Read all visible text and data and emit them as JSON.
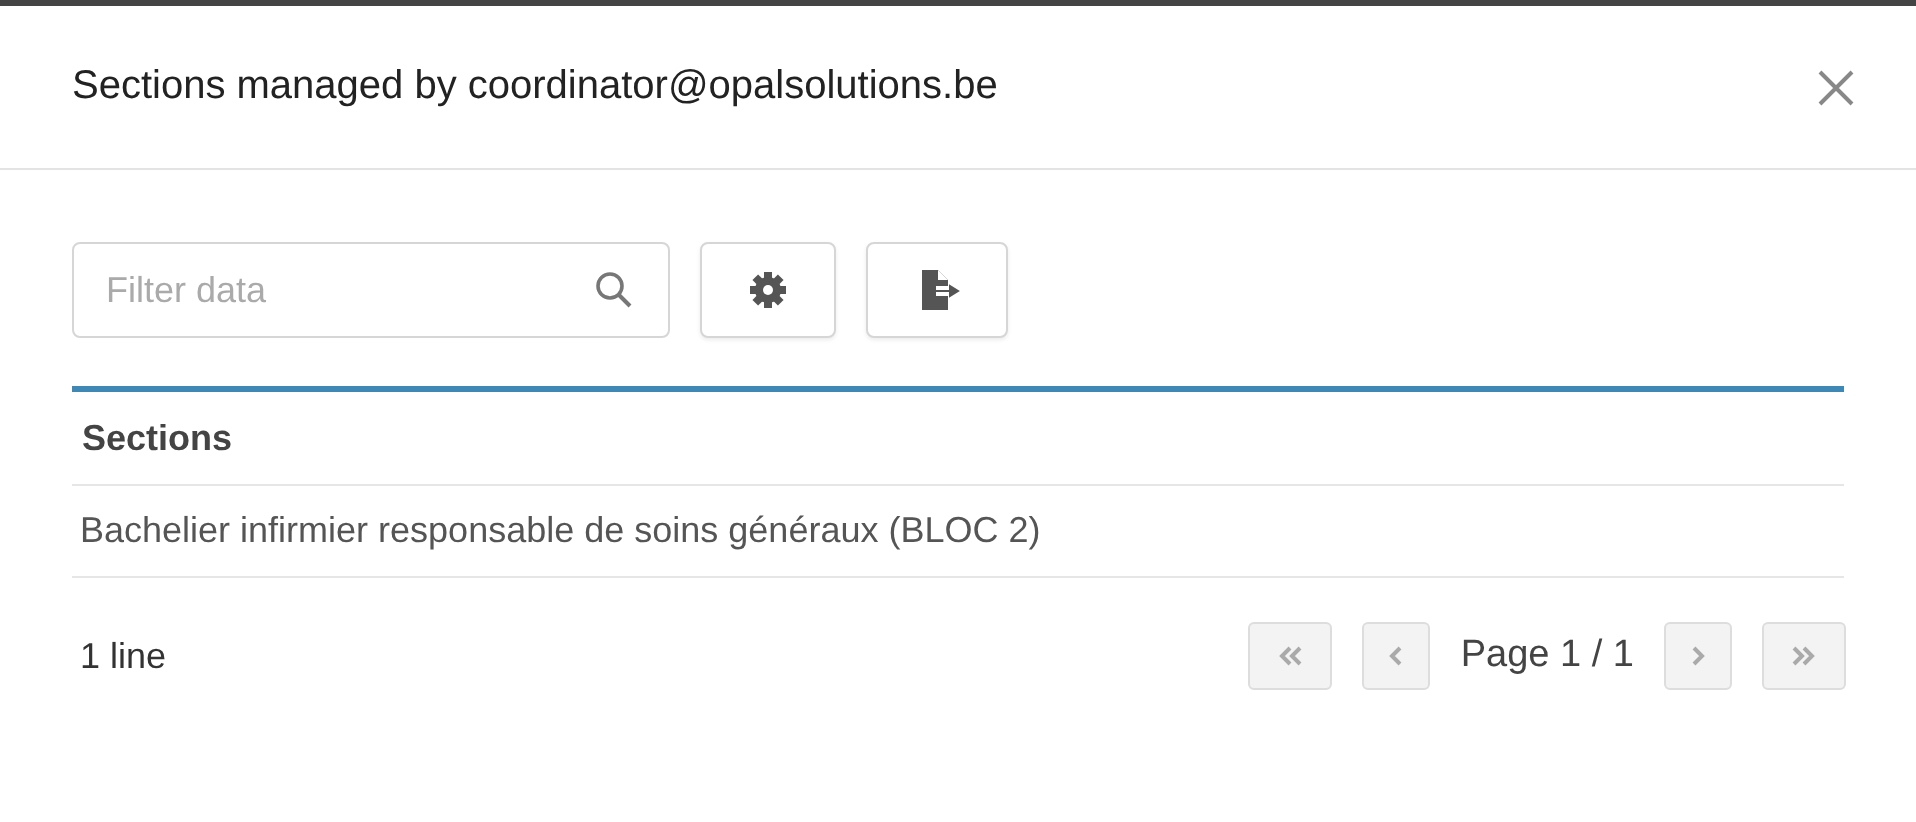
{
  "dialog": {
    "title": "Sections managed by coordinator@opalsolutions.be"
  },
  "toolbar": {
    "filter": {
      "placeholder": "Filter data"
    }
  },
  "table": {
    "columns": [
      "Sections"
    ],
    "rows": [
      [
        "Bachelier infirmier responsable de soins généraux (BLOC 2)"
      ]
    ]
  },
  "footer": {
    "count": "1 line",
    "page": "Page 1 / 1",
    "pager": [
      {
        "kind": "first",
        "disabled": true
      },
      {
        "kind": "prev",
        "disabled": true
      },
      {
        "kind": "next",
        "disabled": true
      },
      {
        "kind": "last",
        "disabled": true
      }
    ]
  }
}
